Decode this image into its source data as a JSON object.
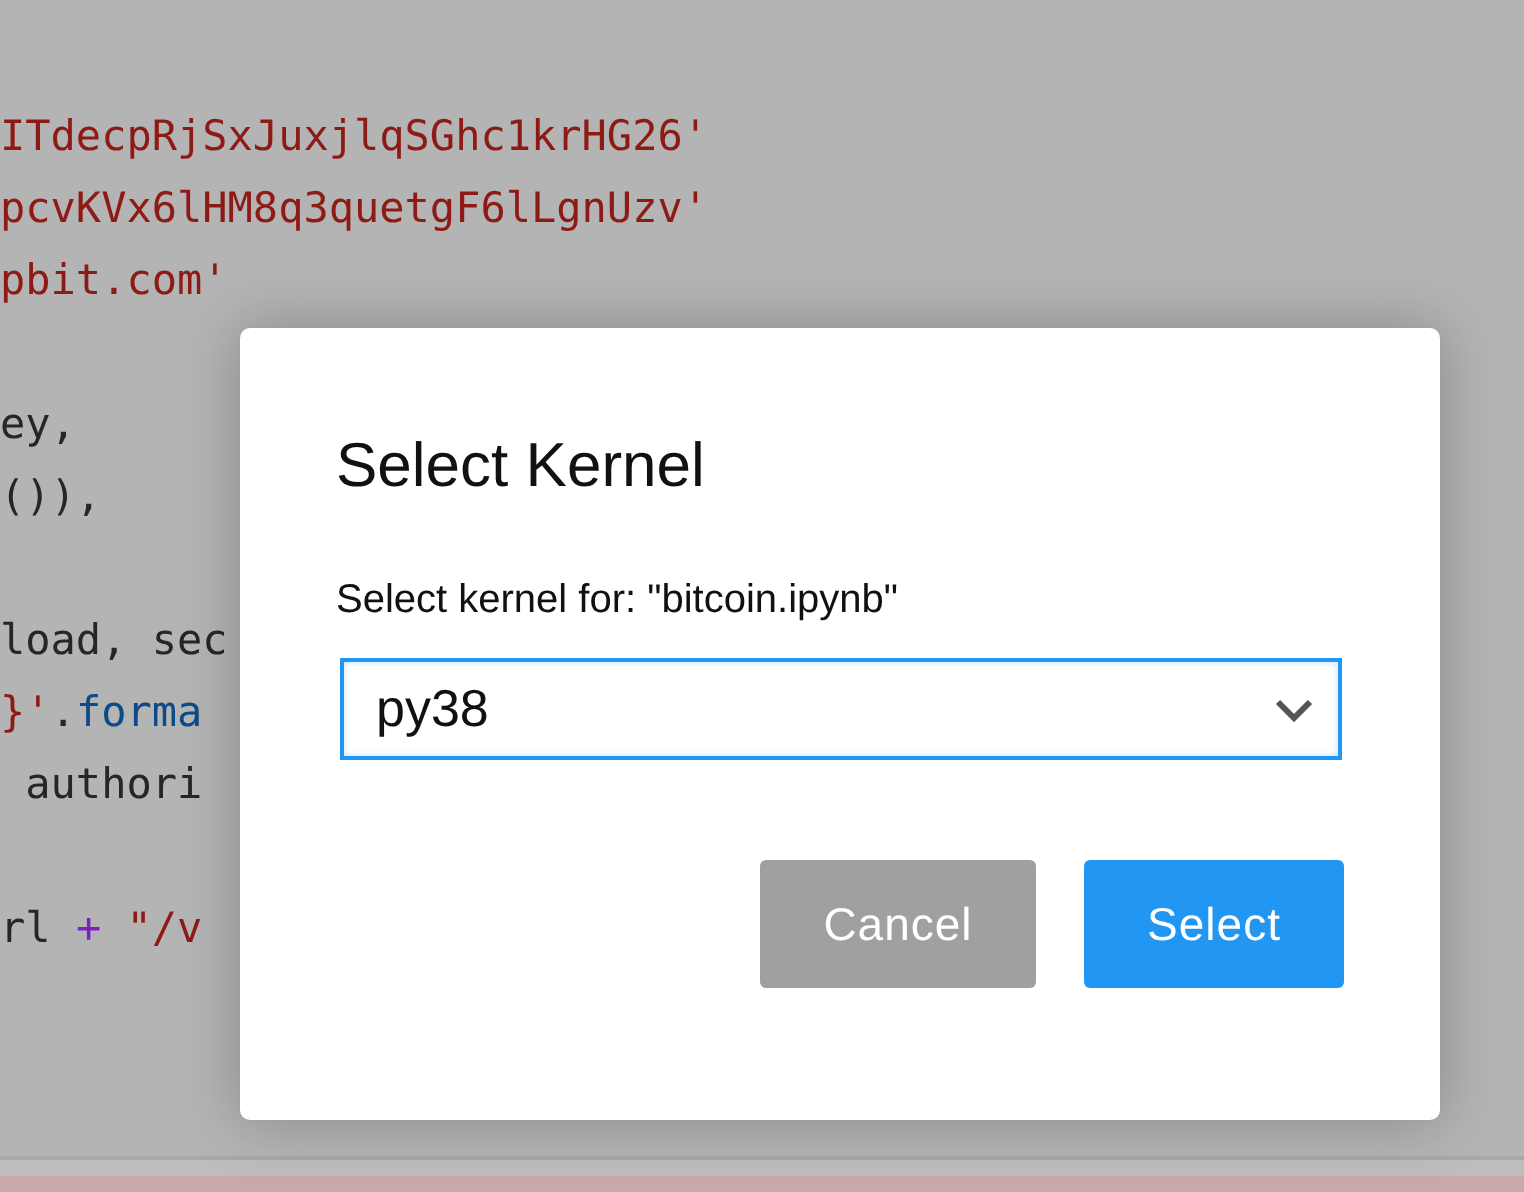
{
  "editor": {
    "code_blocks": [
      [
        [
          {
            "text": "ITdecpRjSxJuxjlqSGhc1krHG26'",
            "kind": "string"
          }
        ],
        [
          {
            "text": "pcvKVx6lHM8q3quetgF6lLgnUzv'",
            "kind": "string"
          }
        ],
        [
          {
            "text": "pbit.com'",
            "kind": "string"
          }
        ]
      ],
      [
        [
          {
            "text": "ey,",
            "kind": "plain"
          }
        ],
        [
          {
            "text": "()),",
            "kind": "plain"
          }
        ]
      ],
      [
        [
          {
            "text": "load, sec",
            "kind": "plain"
          }
        ],
        [
          {
            "text": "}'",
            "kind": "string"
          },
          {
            "text": ".",
            "kind": "plain"
          },
          {
            "text": "forma",
            "kind": "function"
          }
        ],
        [
          {
            "text": " authori",
            "kind": "plain"
          }
        ]
      ],
      [
        [
          {
            "text": "rl ",
            "kind": "plain"
          },
          {
            "text": "+",
            "kind": "operator"
          },
          {
            "text": " \"/v",
            "kind": "string"
          }
        ]
      ]
    ]
  },
  "dialog": {
    "title": "Select Kernel",
    "label": "Select kernel for: \"bitcoin.ipynb\"",
    "select": {
      "value": "py38",
      "focused": true
    },
    "buttons": [
      {
        "label": "Cancel",
        "kind": "secondary"
      },
      {
        "label": "Select",
        "kind": "primary"
      }
    ]
  }
}
